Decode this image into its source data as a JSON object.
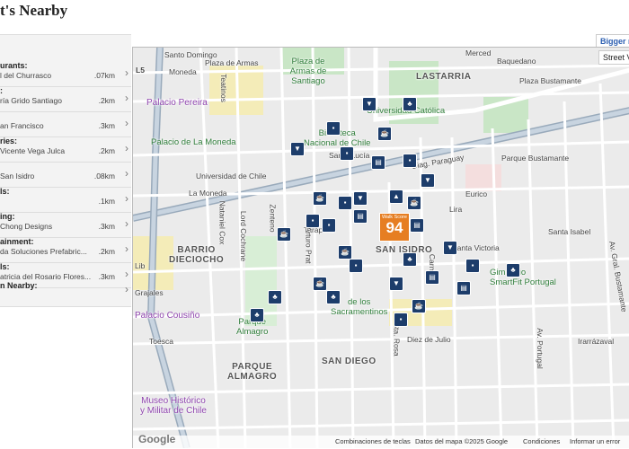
{
  "header": {
    "title": "t's Nearby",
    "bigger_map": "Bigger m"
  },
  "categories": [
    {
      "title": "urants:",
      "place": "l del Churrasco",
      "dist": ".07km"
    },
    {
      "title": ":",
      "place": "ría Grido Santiago",
      "dist": ".2km"
    },
    {
      "title": "",
      "place": "an Francisco",
      "dist": ".3km"
    },
    {
      "title": "ries:",
      "place": "Vicente Vega Julca",
      "dist": ".2km"
    },
    {
      "title": "",
      "place": "San Isidro",
      "dist": ".08km"
    },
    {
      "title": "ls:",
      "place": "",
      "dist": ".1km"
    },
    {
      "title": "ing:",
      "place": " Chong Designs",
      "dist": ".3km"
    },
    {
      "title": "ainment:",
      "place": "da Soluciones Prefabric...",
      "dist": ".2km"
    },
    {
      "title": "ls:",
      "place": "atricia del Rosario Flores...",
      "dist": ".3km"
    },
    {
      "title": "n Nearby:",
      "place": "",
      "dist": ""
    }
  ],
  "map": {
    "walk_score_label": "Walk Score",
    "walk_score": "94",
    "street_view": "Street V",
    "labels": {
      "santo_domingo": "Santo Domingo",
      "merced": "Merced",
      "baquedano": "Baquedano",
      "plaza_armas": "Plaza de Armas",
      "plaza_armas_santiago": "Plaza de Armas de Santiago",
      "lastarria": "LASTARRIA",
      "l5": "L5",
      "teatinos": "Teatinos",
      "moneda": "Moneda",
      "universidad_catolica": "Universidad Católica",
      "plaza_bustamante": "Plaza Bustamante",
      "palacio_pereira": "Palacio Pereira",
      "palacio_moneda": "Palacio de La Moneda",
      "biblioteca": "Biblioteca\nNacional de Chile",
      "santa_lucia": "Santa Lucía",
      "diag_paraguay": "Diag. Paraguay",
      "parque_bustamante": "Parque Bustamante",
      "universidad_chile": "Universidad de Chile",
      "la_moneda": "La Moneda",
      "eurico": "Eurico",
      "santa_isabel": "Santa Isabel",
      "barrio_dieciocho": "BARRIO\nDIECIOCHO",
      "san_isidro": "SAN ISIDRO",
      "tarapaca": "Tarapacá",
      "lira": "Lira",
      "carmen": "Carmen",
      "gimnasio": "Gimnasio\nSmartFit Portugal",
      "palacio_cousino": "Palacio Cousiño",
      "sacramentinos": "de los\nSacramentinos",
      "parque_almagro": "Parque\nAlmagro",
      "toesca": "Toesca",
      "diez_julio": "Diez de Julio",
      "irarrazaval": "Irarrázaval",
      "parque_almagro_big": "PARQUE\nALMAGRO",
      "san_diego": "SAN DIEGO",
      "museo": "Museo Histórico\ny Militar de Chile",
      "av_portugal": "Av. Portugal",
      "santa_victoria": "Santa Victoria",
      "nataniel_cox": "Nataniel Cox",
      "lord_cochrane": "Lord Cochrane",
      "zenteno": "Zenteno",
      "arturo_prat": "Arturo Prat",
      "sta_rosa": "Sta. Rosa",
      "gral_bustamante": "Av. Gral. Bustamante",
      "grajales": "Grajales",
      "lib": "Lib"
    }
  },
  "footer": {
    "google": "Google",
    "shortcuts": "Combinaciones de teclas",
    "data": "Datos del mapa ©2025 Google",
    "terms": "Condiciones",
    "report": "Informar un error"
  }
}
